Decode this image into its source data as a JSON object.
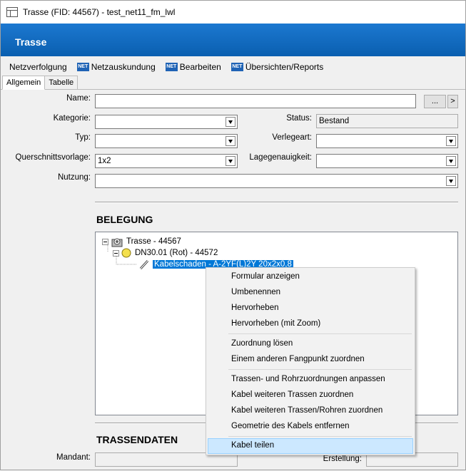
{
  "window": {
    "title": "Trasse (FID: 44567) - test_net11_fm_lwl",
    "icon": "table-window-icon"
  },
  "banner": {
    "title": "Trasse"
  },
  "menu": {
    "items": [
      {
        "label": "Netzverfolgung",
        "badge": ""
      },
      {
        "label": "Netzauskundung",
        "badge": "NET"
      },
      {
        "label": "Bearbeiten",
        "badge": "NET"
      },
      {
        "label": "Übersichten/Reports",
        "badge": "NET"
      }
    ]
  },
  "tabs": [
    {
      "label": "Allgemein",
      "active": true
    },
    {
      "label": "Tabelle",
      "active": false
    }
  ],
  "form": {
    "name_label": "Name:",
    "name_value": "",
    "browse_label": "...",
    "next_label": ">",
    "kategorie_label": "Kategorie:",
    "kategorie_value": "",
    "status_label": "Status:",
    "status_value": "Bestand",
    "typ_label": "Typ:",
    "typ_value": "",
    "verlegeart_label": "Verlegeart:",
    "verlegeart_value": "",
    "querschnitt_label": "Querschnittsvorlage:",
    "querschnitt_value": "1x2",
    "lagegenau_label": "Lagegenauigkeit:",
    "lagegenau_value": "",
    "nutzung_label": "Nutzung:",
    "nutzung_value": ""
  },
  "belegung": {
    "title": "BELEGUNG",
    "tree": {
      "root": "Trasse - 44567",
      "child": "DN30.01 (Rot) - 44572",
      "leaf": "Kabelschaden - A-2YF(L)2Y 20x2x0,8"
    }
  },
  "context_menu": {
    "groups": [
      [
        "Formular anzeigen",
        "Umbenennen",
        "Hervorheben",
        "Hervorheben (mit Zoom)"
      ],
      [
        "Zuordnung lösen",
        "Einem anderen Fangpunkt zuordnen"
      ],
      [
        "Trassen- und Rohrzuordnungen anpassen",
        "Kabel weiteren Trassen zuordnen",
        "Kabel weiteren Trassen/Rohren zuordnen",
        "Geometrie des Kabels entfernen"
      ],
      [
        "Kabel teilen"
      ]
    ],
    "hovered": "Kabel teilen"
  },
  "trassendaten": {
    "title": "TRASSENDATEN",
    "mandant_label": "Mandant:",
    "erstellung_label": "Erstellung:"
  }
}
